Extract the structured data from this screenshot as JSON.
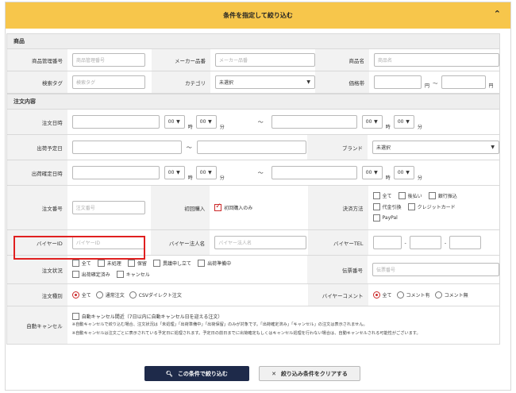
{
  "header": {
    "title": "条件を指定して絞り込む",
    "collapse_icon": "chevron-up-icon"
  },
  "sections": {
    "product": "商品",
    "order": "注文内容"
  },
  "product": {
    "manage_no_label": "商品管理番号",
    "manage_no_placeholder": "商品管理番号",
    "maker_no_label": "メーカー品番",
    "maker_no_placeholder": "メーカー品番",
    "name_label": "商品名",
    "name_placeholder": "商品名",
    "tag_label": "検索タグ",
    "tag_placeholder": "検索タグ",
    "category_label": "カテゴリ",
    "category_value": "未選択",
    "price_label": "価格帯",
    "price_unit": "円",
    "price_tilde": "〜"
  },
  "order": {
    "date_label": "注文日時",
    "hour_value": "00",
    "hour_unit": "時",
    "min_value": "00",
    "min_unit": "分",
    "tilde": "〜",
    "ship_plan_label": "出荷予定日",
    "brand_label": "ブランド",
    "brand_value": "未選択",
    "ship_confirm_label": "出荷確定日時",
    "order_no_label": "注文番号",
    "order_no_placeholder": "注文番号",
    "first_label": "初回購入",
    "first_option": "初回購入のみ",
    "payment_label": "決済方法",
    "payment_options": [
      "全て",
      "後払い",
      "銀行振込",
      "代金引換",
      "クレジットカード",
      "PayPal"
    ],
    "buyer_id_label": "バイヤーID",
    "buyer_id_placeholder": "バイヤーID",
    "buyer_corp_label": "バイヤー法人名",
    "buyer_corp_placeholder": "バイヤー法人名",
    "buyer_tel_label": "バイヤーTEL",
    "tel_sep": "-",
    "status_label": "注文状況",
    "status_options": [
      "全て",
      "未処理",
      "保留",
      "異議申し立て",
      "出荷準備中",
      "出荷確定済み",
      "キャンセル"
    ],
    "slip_label": "伝票番号",
    "slip_placeholder": "伝票番号",
    "type_label": "注文種別",
    "type_options": [
      "全て",
      "通常注文",
      "CSVダイレクト注文"
    ],
    "comment_label": "バイヤーコメント",
    "comment_options": [
      "全て",
      "コメント有",
      "コメント無"
    ],
    "auto_cancel_label": "自動キャンセル",
    "auto_cancel_option": "自動キャンセル間近（7日以内に自動キャンセル日を迎える注文）",
    "note1": "※自動キャンセルで絞り込む場合、注文状況は「未処理」「出荷準備中」「出荷保留」のみが対象です。「出荷確定済み」「キャンセル」の注文は表示されません。",
    "note2": "※自動キャンセルは注文ごとに表示されている予定日に処理されます。予定日の前日までに出荷確定もしくはキャンセル処理を行わない場合は、自動キャンセルされる可能性がございます。"
  },
  "buttons": {
    "search": "この条件で絞り込む",
    "clear": "絞り込み条件をクリアする"
  }
}
